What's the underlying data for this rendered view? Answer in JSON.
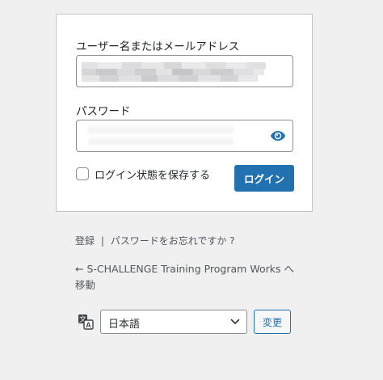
{
  "login_form": {
    "username_label": "ユーザー名またはメールアドレス",
    "username_value": "",
    "password_label": "パスワード",
    "password_value": "",
    "show_password_icon": "eye-icon",
    "remember_label": "ログイン状態を保存する",
    "remember_checked": false,
    "submit_label": "ログイン"
  },
  "links": {
    "register": "登録",
    "separator": "|",
    "lost_password": "パスワードをお忘れですか ?",
    "back_to_site": "← S-CHALLENGE Training Program Works へ移動"
  },
  "language": {
    "icon": "translate-icon",
    "selected": "日本語",
    "change_label": "変更"
  },
  "colors": {
    "primary": "#2271b1",
    "background": "#f0f0f1",
    "text": "#1d2327",
    "muted_text": "#50575e"
  }
}
